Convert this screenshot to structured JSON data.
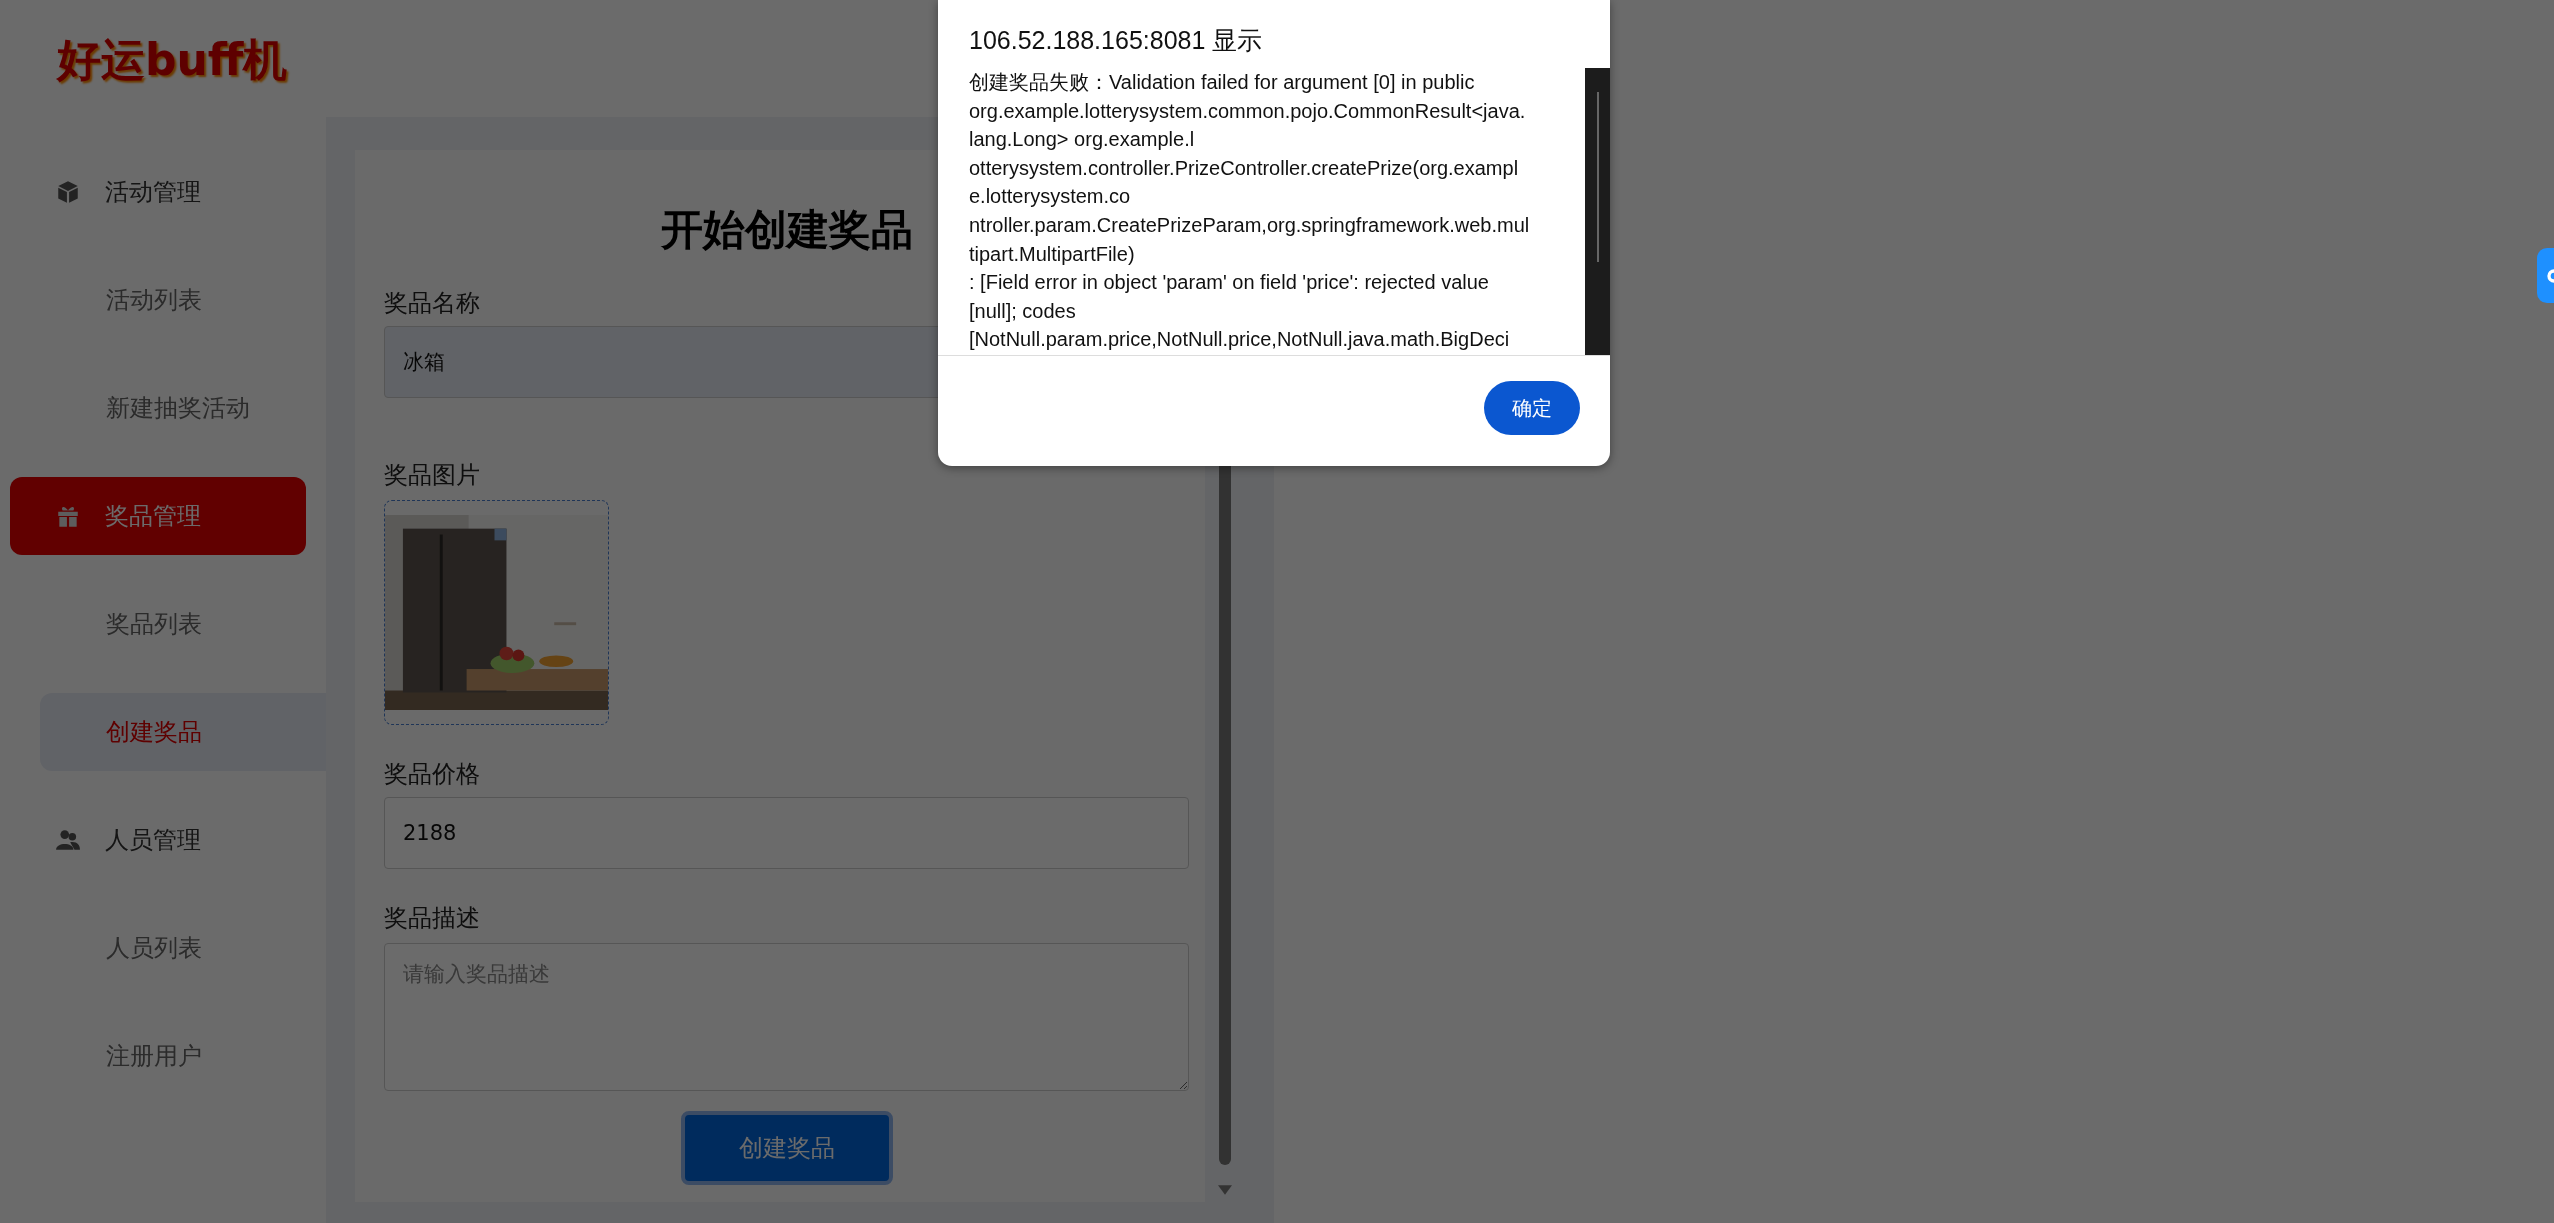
{
  "logo": "好运buff机",
  "sidebar": {
    "groups": [
      {
        "label": "活动管理",
        "selected": false,
        "children": [
          {
            "label": "活动列表",
            "selected": false
          },
          {
            "label": "新建抽奖活动",
            "selected": false
          }
        ]
      },
      {
        "label": "奖品管理",
        "selected": true,
        "children": [
          {
            "label": "奖品列表",
            "selected": false
          },
          {
            "label": "创建奖品",
            "selected": true
          }
        ]
      },
      {
        "label": "人员管理",
        "selected": false,
        "children": [
          {
            "label": "人员列表",
            "selected": false
          },
          {
            "label": "注册用户",
            "selected": false
          }
        ]
      }
    ]
  },
  "form": {
    "title": "开始创建奖品",
    "name": {
      "label": "奖品名称",
      "value": "冰箱"
    },
    "image": {
      "label": "奖品图片",
      "kind": "picture"
    },
    "price": {
      "label": "奖品价格",
      "value": "2188"
    },
    "description": {
      "label": "奖品描述",
      "placeholder": "请输入奖品描述"
    },
    "submit": "创建奖品"
  },
  "dialog": {
    "title": "106.52.188.165:8081 显示",
    "message_lines": [
      "创建奖品失败：Validation failed for argument [0] in public",
      "org.example.lotterysystem.common.pojo.CommonResult<java.",
      "lang.Long> org.example.l",
      "otterysystem.controller.PrizeController.createPrize(org.exampl",
      "e.lotterysystem.co",
      "ntroller.param.CreatePrizeParam,org.springframework.web.mul",
      "tipart.MultipartFile)",
      ": [Field error in object 'param' on field 'price': rejected value",
      "[null]; codes",
      "[NotNull.param.price,NotNull.price,NotNull.java.math.BigDeci"
    ],
    "ok": "确定"
  }
}
